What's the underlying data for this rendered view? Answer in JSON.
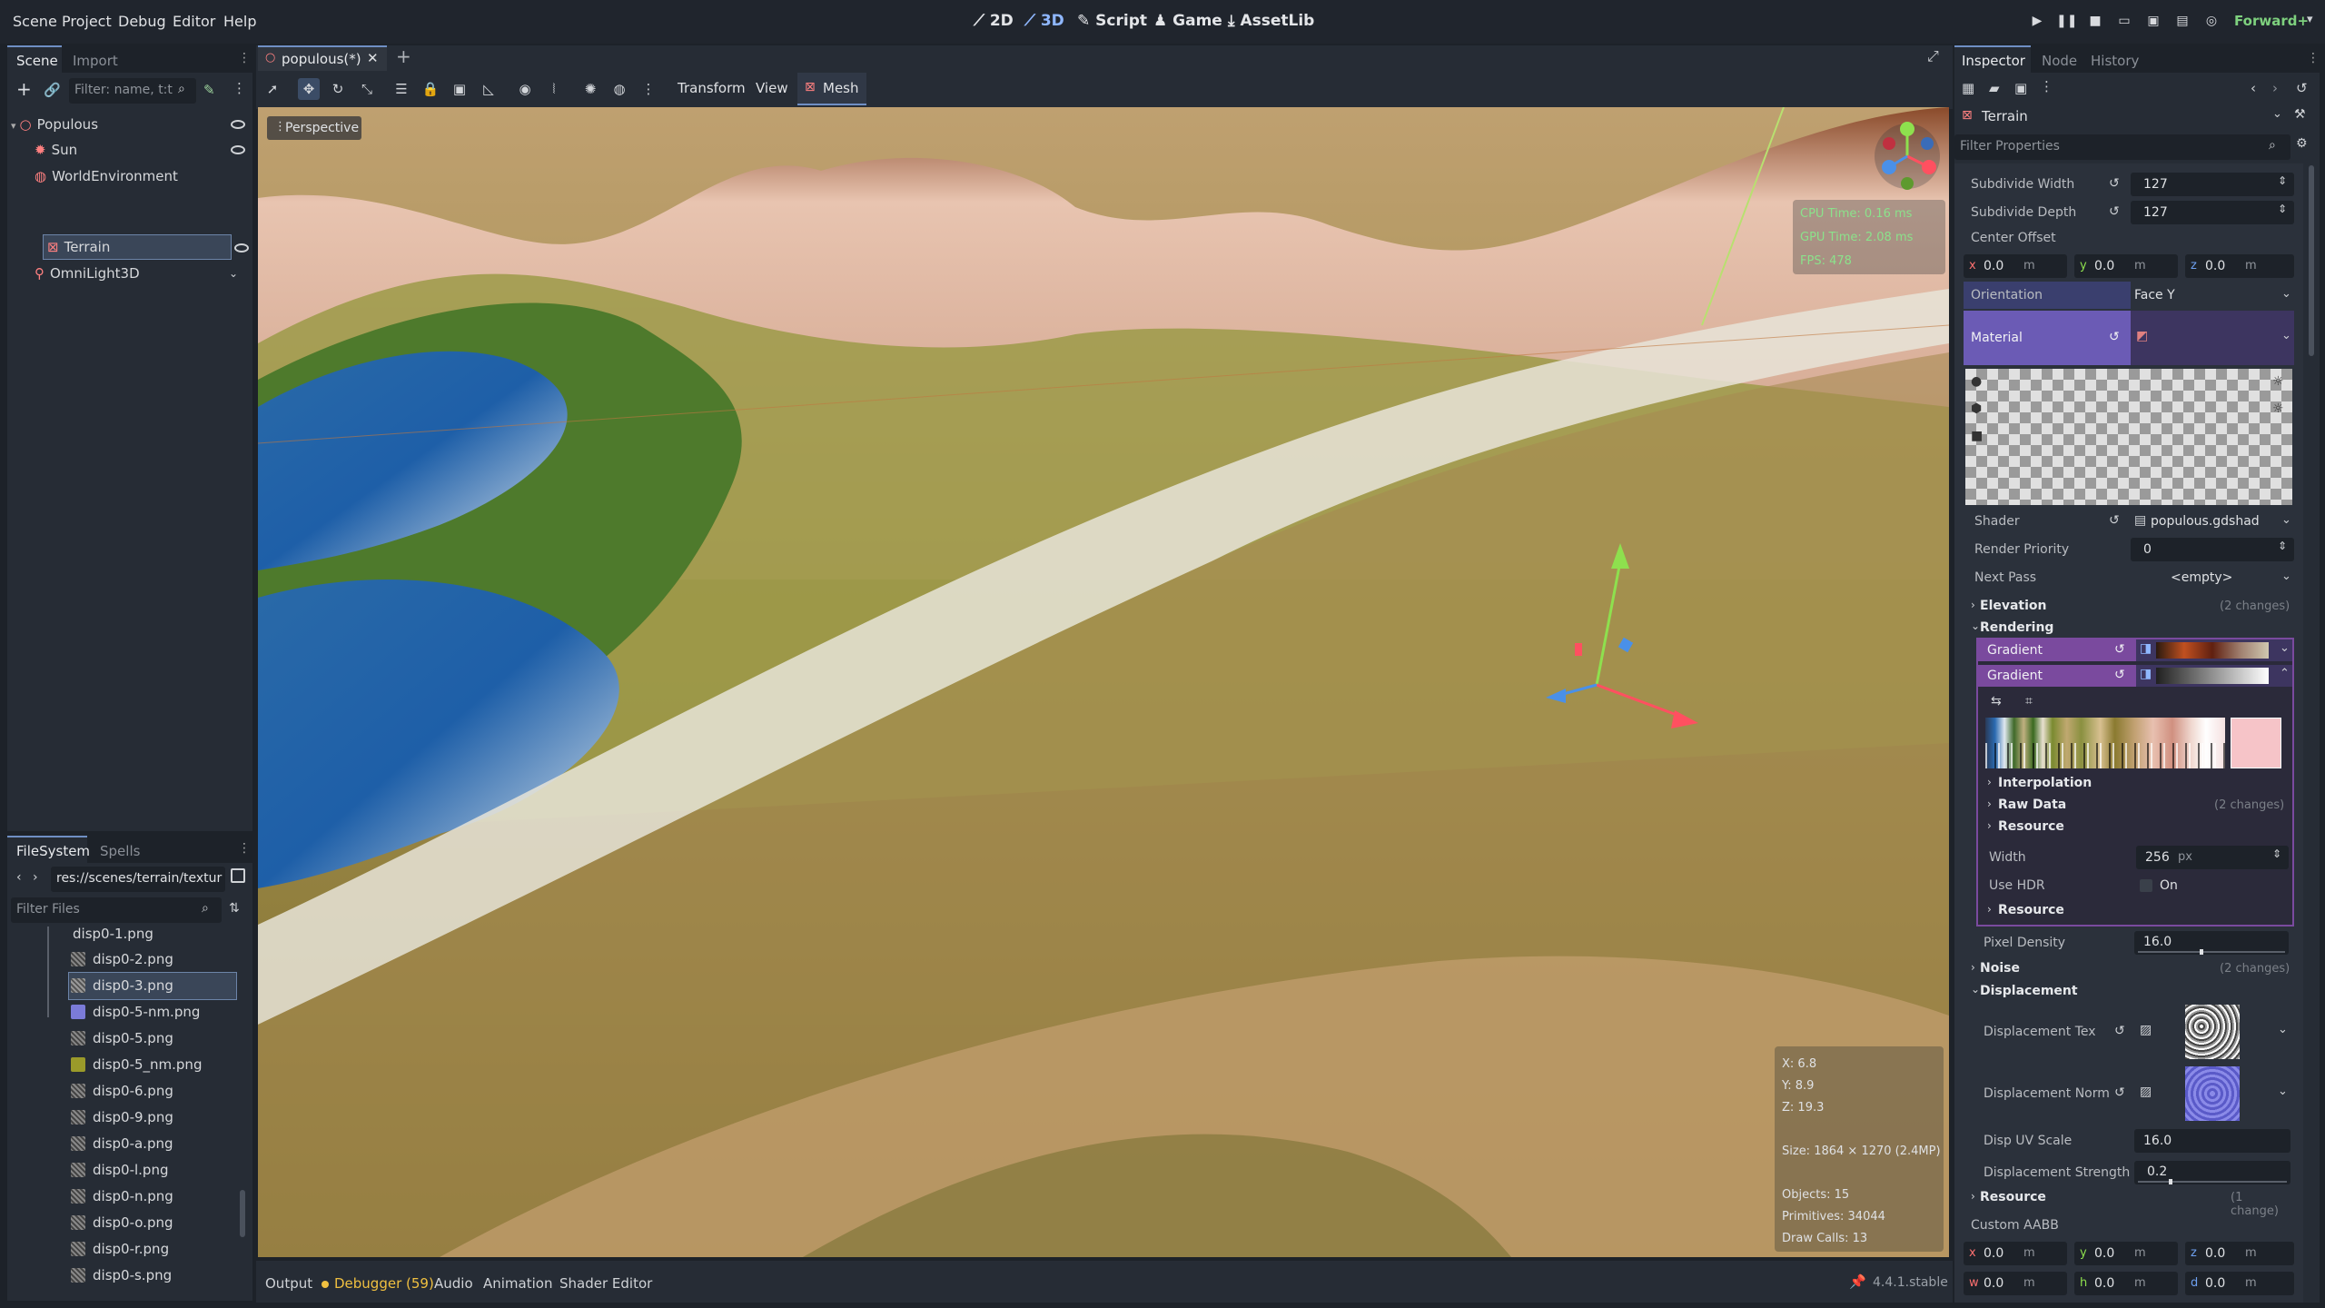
{
  "menubar": {
    "menus": [
      "Scene",
      "Project",
      "Debug",
      "Editor",
      "Help"
    ],
    "workspaces": {
      "w2d": "2D",
      "w3d": "3D",
      "script": "Script",
      "game": "Game",
      "assetlib": "AssetLib"
    },
    "renderer": "Forward+"
  },
  "scene_dock": {
    "tabs": {
      "scene": "Scene",
      "import": "Import"
    },
    "filter_placeholder": "Filter: name, t:t",
    "nodes": [
      "Populous",
      "Sun",
      "WorldEnvironment",
      "Terrain",
      "OmniLight3D"
    ]
  },
  "filesystem_dock": {
    "tabs": {
      "filesystem": "FileSystem",
      "spells": "Spells"
    },
    "path": "res://scenes/terrain/textur",
    "filter_placeholder": "Filter Files",
    "files": [
      "disp0-1.png",
      "disp0-2.png",
      "disp0-3.png",
      "disp0-5-nm.png",
      "disp0-5.png",
      "disp0-5_nm.png",
      "disp0-6.png",
      "disp0-9.png",
      "disp0-a.png",
      "disp0-l.png",
      "disp0-n.png",
      "disp0-o.png",
      "disp0-r.png",
      "disp0-s.png"
    ]
  },
  "editor": {
    "scene_tab": "populous(*)",
    "toolbar": {
      "transform": "Transform",
      "view": "View",
      "mesh": "Mesh"
    },
    "perspective_label": "Perspective",
    "stats": {
      "cpu": "CPU Time: 0.16 ms",
      "gpu": "GPU Time: 2.08 ms",
      "fps": "FPS: 478"
    },
    "info": {
      "x": "X: 6.8",
      "y": "Y: 8.9",
      "z": "Z: 19.3",
      "size": "Size: 1864 × 1270 (2.4MP)",
      "objects": "Objects: 15",
      "primitives": "Primitives: 34044",
      "drawcalls": "Draw Calls: 13"
    }
  },
  "bottom_panel": {
    "tabs": {
      "output": "Output",
      "debugger": "Debugger (59)",
      "audio": "Audio",
      "animation": "Animation",
      "shader": "Shader Editor"
    },
    "version": "4.4.1.stable"
  },
  "inspector": {
    "tabs": {
      "inspector": "Inspector",
      "node": "Node",
      "history": "History"
    },
    "object_name": "Terrain",
    "filter_placeholder": "Filter Properties",
    "subdivide_width": {
      "label": "Subdivide Width",
      "value": "127"
    },
    "subdivide_depth": {
      "label": "Subdivide Depth",
      "value": "127"
    },
    "center_offset": {
      "label": "Center Offset",
      "x": "0.0",
      "y": "0.0",
      "z": "0.0",
      "unit": "m",
      "xl": "x",
      "yl": "y",
      "zl": "z"
    },
    "orientation": {
      "label": "Orientation",
      "value": "Face Y"
    },
    "material": {
      "label": "Material"
    },
    "shader": {
      "label": "Shader",
      "value": "populous.gdshad"
    },
    "render_priority": {
      "label": "Render Priority",
      "value": "0"
    },
    "next_pass": {
      "label": "Next Pass",
      "value": "<empty>"
    },
    "elevation": {
      "label": "Elevation",
      "changes": "(2 changes)"
    },
    "rendering": {
      "label": "Rendering"
    },
    "gradient1": {
      "label": "Gradient"
    },
    "gradient2": {
      "label": "Gradient"
    },
    "interpolation": "Interpolation",
    "raw_data": {
      "label": "Raw Data",
      "changes": "(2 changes)"
    },
    "resource_inner": "Resource",
    "width": {
      "label": "Width",
      "value": "256",
      "unit": "px"
    },
    "use_hdr": {
      "label": "Use HDR",
      "value": "On"
    },
    "resource_inner2": "Resource",
    "pixel_density": {
      "label": "Pixel Density",
      "value": "16.0"
    },
    "noise": {
      "label": "Noise",
      "changes": "(2 changes)"
    },
    "displacement": {
      "label": "Displacement"
    },
    "displacement_tex": {
      "label": "Displacement Tex"
    },
    "displacement_norm": {
      "label": "Displacement Norm"
    },
    "disp_uv_scale": {
      "label": "Disp UV Scale",
      "value": "16.0"
    },
    "disp_strength": {
      "label": "Displacement Strength",
      "value": "0.2"
    },
    "resource": {
      "label": "Resource",
      "changes": "(1 change)"
    },
    "custom_aabb": {
      "label": "Custom AABB",
      "x": "0.0",
      "y": "0.0",
      "z": "0.0",
      "w": "0.0",
      "h": "0.0",
      "d": "0.0",
      "unit": "m",
      "xl": "x",
      "yl": "y",
      "zl": "z",
      "wl": "w",
      "hl": "h",
      "dl": "d"
    }
  },
  "colors": {
    "accent": "#8fb7ff",
    "material_bg": "#6b5bb5",
    "gradient_bg": "#7a4a9e",
    "stats": "#8be28b"
  }
}
